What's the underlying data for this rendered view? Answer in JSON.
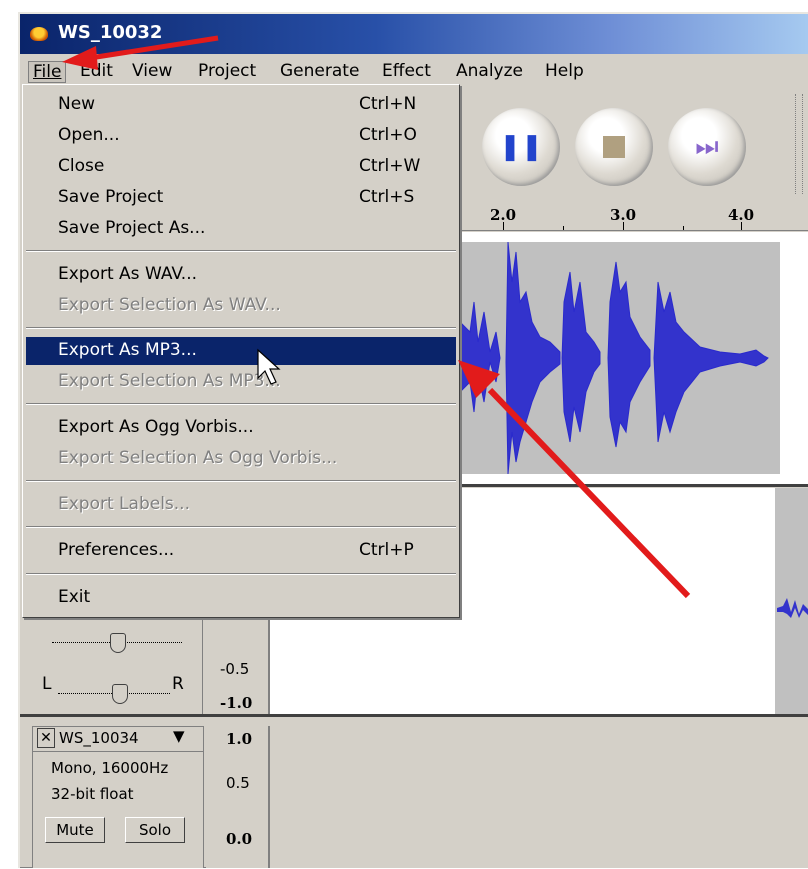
{
  "window": {
    "title": "WS_10032"
  },
  "menubar": {
    "items": [
      "File",
      "Edit",
      "View",
      "Project",
      "Generate",
      "Effect",
      "Analyze",
      "Help"
    ]
  },
  "file_menu": {
    "items": [
      {
        "label": "New",
        "shortcut": "Ctrl+N",
        "enabled": true
      },
      {
        "label": "Open...",
        "shortcut": "Ctrl+O",
        "enabled": true
      },
      {
        "label": "Close",
        "shortcut": "Ctrl+W",
        "enabled": true
      },
      {
        "label": "Save Project",
        "shortcut": "Ctrl+S",
        "enabled": true
      },
      {
        "label": "Save Project As...",
        "shortcut": "",
        "enabled": true
      },
      {
        "label": "Export As WAV...",
        "shortcut": "",
        "enabled": true
      },
      {
        "label": "Export Selection As WAV...",
        "shortcut": "",
        "enabled": false
      },
      {
        "label": "Export As MP3...",
        "shortcut": "",
        "enabled": true,
        "highlighted": true
      },
      {
        "label": "Export Selection As MP3...",
        "shortcut": "",
        "enabled": false
      },
      {
        "label": "Export As Ogg Vorbis...",
        "shortcut": "",
        "enabled": true
      },
      {
        "label": "Export Selection As Ogg Vorbis...",
        "shortcut": "",
        "enabled": false
      },
      {
        "label": "Export Labels...",
        "shortcut": "",
        "enabled": false
      },
      {
        "label": "Preferences...",
        "shortcut": "Ctrl+P",
        "enabled": true
      },
      {
        "label": "Exit",
        "shortcut": "",
        "enabled": true
      }
    ]
  },
  "toolbar": {
    "buttons": [
      "pause-icon",
      "stop-icon",
      "skip-end-icon"
    ]
  },
  "ruler": {
    "ticks": [
      "2.0",
      "3.0",
      "4.0"
    ]
  },
  "track2": {
    "scale": [
      "-0.5",
      "-1.0"
    ],
    "pan_left": "L",
    "pan_right": "R"
  },
  "track3": {
    "name": "WS_10034",
    "info1": "Mono, 16000Hz",
    "info2": "32-bit float",
    "mute_label": "Mute",
    "solo_label": "Solo",
    "close_glyph": "✕",
    "scale": [
      "1.0",
      "0.5",
      "0.0"
    ]
  },
  "colors": {
    "waveform": "#3333cc",
    "highlight": "#0a246a",
    "annotation_arrow": "#e21b1b"
  }
}
